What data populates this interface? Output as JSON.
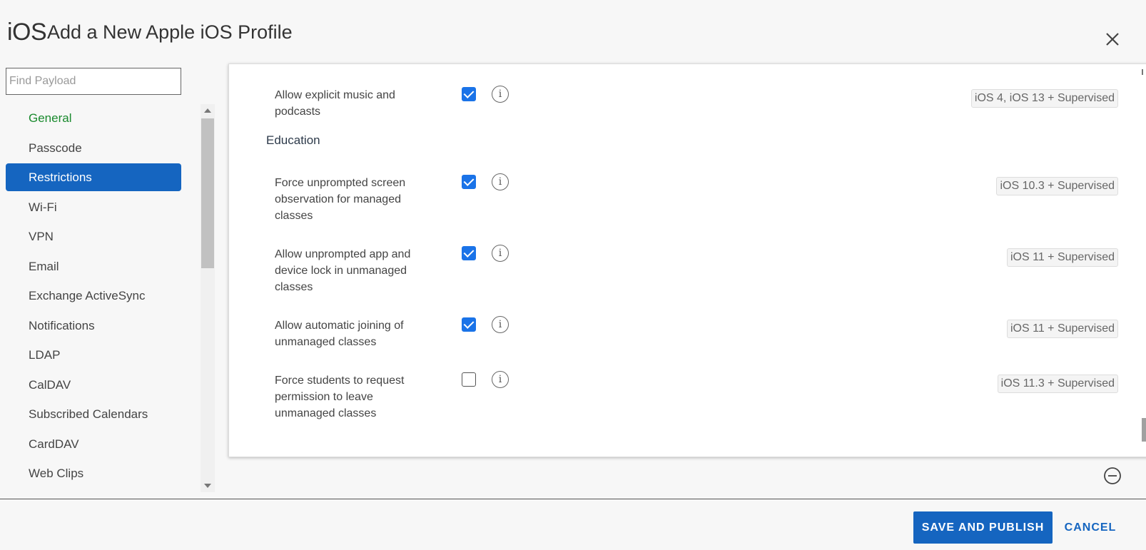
{
  "header": {
    "os_logo": "iOS",
    "title": "Add a New Apple iOS Profile"
  },
  "search": {
    "placeholder": "Find Payload",
    "value": ""
  },
  "sidebar": {
    "items": [
      {
        "label": "General"
      },
      {
        "label": "Passcode"
      },
      {
        "label": "Restrictions"
      },
      {
        "label": "Wi-Fi"
      },
      {
        "label": "VPN"
      },
      {
        "label": "Email"
      },
      {
        "label": "Exchange ActiveSync"
      },
      {
        "label": "Notifications"
      },
      {
        "label": "LDAP"
      },
      {
        "label": "CalDAV"
      },
      {
        "label": "Subscribed Calendars"
      },
      {
        "label": "CardDAV"
      },
      {
        "label": "Web Clips"
      }
    ],
    "selected": "Restrictions"
  },
  "panel": {
    "top_row": {
      "label": "Allow explicit music and podcasts",
      "checked": true,
      "badge": "iOS 4, iOS 13 + Supervised"
    },
    "section_title": "Education",
    "rows": [
      {
        "label": "Force unprompted screen observation for managed classes",
        "checked": true,
        "badge": "iOS 10.3 + Supervised"
      },
      {
        "label": "Allow unprompted app and device lock in unmanaged classes",
        "checked": true,
        "badge": "iOS 11 + Supervised"
      },
      {
        "label": "Allow automatic joining of unmanaged classes",
        "checked": true,
        "badge": "iOS 11 + Supervised"
      },
      {
        "label": "Force students to request permission to leave unmanaged classes",
        "checked": false,
        "badge": "iOS 11.3 + Supervised"
      }
    ],
    "info_glyph": "i"
  },
  "footer": {
    "save_label": "SAVE AND PUBLISH",
    "cancel_label": "CANCEL"
  },
  "colors": {
    "accent": "#1565c0",
    "general_green": "#1a8a2e",
    "checkbox_blue": "#1a73e8"
  },
  "icons": {
    "close": "close-icon",
    "collapse": "minus-circle-icon",
    "info": "info-icon"
  }
}
